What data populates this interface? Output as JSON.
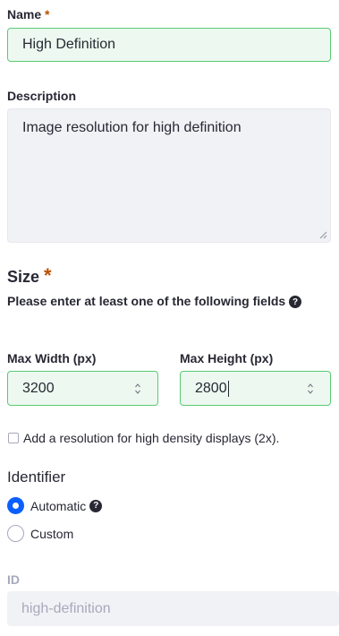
{
  "name": {
    "label": "Name",
    "required": "*",
    "value": "High Definition"
  },
  "description": {
    "label": "Description",
    "value": "Image resolution for high definition"
  },
  "size": {
    "title": "Size",
    "required": "*",
    "hint": "Please enter at least one of the following fields",
    "help_icon": "question-icon"
  },
  "max_width": {
    "label": "Max Width (px)",
    "value": "3200"
  },
  "max_height": {
    "label": "Max Height (px)",
    "value": "2800"
  },
  "high_density": {
    "label": "Add a resolution for high density displays (2x).",
    "checked": false
  },
  "identifier": {
    "title": "Identifier",
    "options": [
      {
        "label": "Automatic",
        "selected": true
      },
      {
        "label": "Custom",
        "selected": false
      }
    ]
  },
  "id_field": {
    "label": "ID",
    "placeholder": "high-definition"
  },
  "colors": {
    "accent": "#0b5fff",
    "valid_border": "#5aca75",
    "valid_bg": "#edf9f0",
    "required": "#b95000"
  }
}
